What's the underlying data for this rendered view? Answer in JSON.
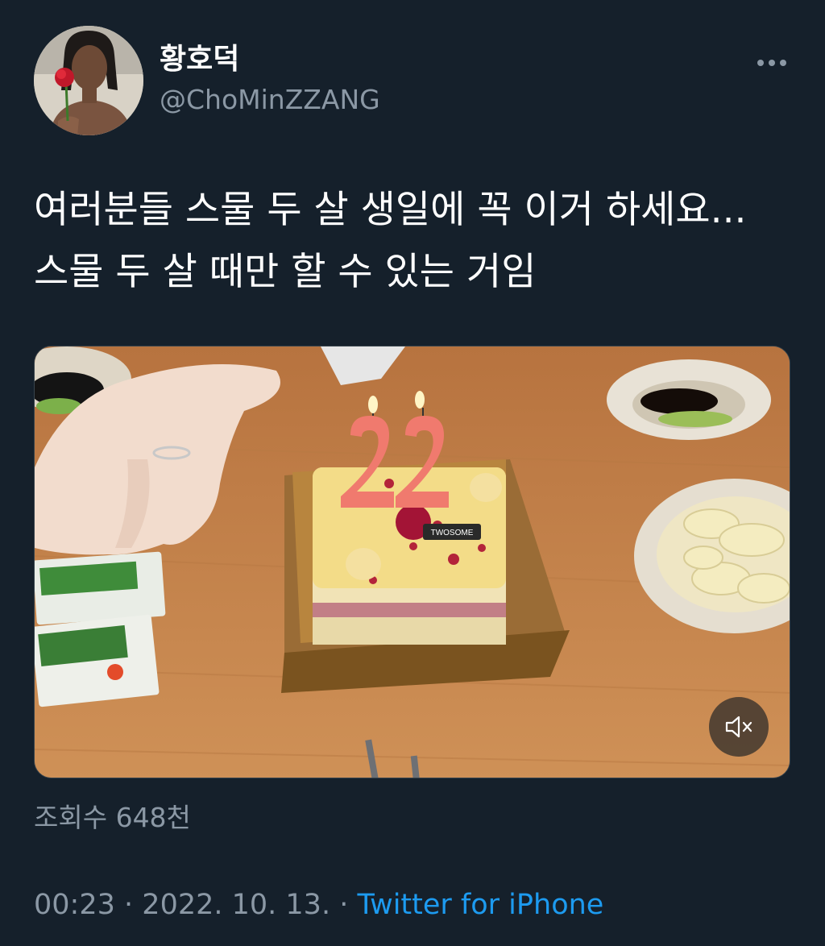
{
  "tweet": {
    "display_name": "황호덕",
    "handle": "@ChoMinZZANG",
    "text": "여러분들 스물 두 살 생일에 꼭 이거 하세요... 스물 두 살 때만 할 수 있는 거임",
    "more_icon": "more-horizontal-icon"
  },
  "media": {
    "type": "video",
    "cake_plate_text": "TWOSOME",
    "candle_text": "22",
    "mute_icon": "volume-muted-icon"
  },
  "stats": {
    "views": "조회수 648천"
  },
  "meta": {
    "time": "00:23",
    "separator": "·",
    "date": "2022. 10. 13.",
    "source": "Twitter for iPhone"
  },
  "colors": {
    "background": "#15202b",
    "secondary_text": "#8b98a5",
    "link": "#1d9bf0"
  }
}
